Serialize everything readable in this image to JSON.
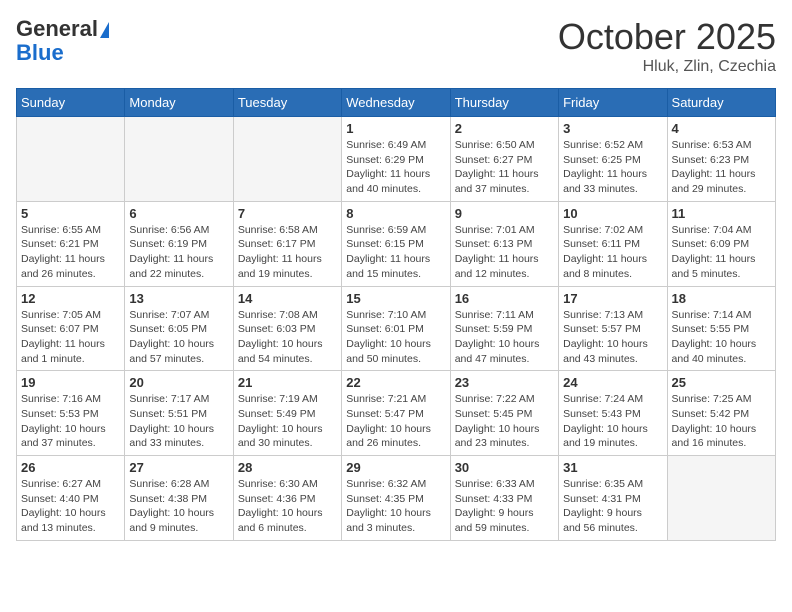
{
  "header": {
    "logo_general": "General",
    "logo_blue": "Blue",
    "month": "October 2025",
    "location": "Hluk, Zlin, Czechia"
  },
  "days_of_week": [
    "Sunday",
    "Monday",
    "Tuesday",
    "Wednesday",
    "Thursday",
    "Friday",
    "Saturday"
  ],
  "weeks": [
    [
      {
        "day": "",
        "info": ""
      },
      {
        "day": "",
        "info": ""
      },
      {
        "day": "",
        "info": ""
      },
      {
        "day": "1",
        "info": "Sunrise: 6:49 AM\nSunset: 6:29 PM\nDaylight: 11 hours\nand 40 minutes."
      },
      {
        "day": "2",
        "info": "Sunrise: 6:50 AM\nSunset: 6:27 PM\nDaylight: 11 hours\nand 37 minutes."
      },
      {
        "day": "3",
        "info": "Sunrise: 6:52 AM\nSunset: 6:25 PM\nDaylight: 11 hours\nand 33 minutes."
      },
      {
        "day": "4",
        "info": "Sunrise: 6:53 AM\nSunset: 6:23 PM\nDaylight: 11 hours\nand 29 minutes."
      }
    ],
    [
      {
        "day": "5",
        "info": "Sunrise: 6:55 AM\nSunset: 6:21 PM\nDaylight: 11 hours\nand 26 minutes."
      },
      {
        "day": "6",
        "info": "Sunrise: 6:56 AM\nSunset: 6:19 PM\nDaylight: 11 hours\nand 22 minutes."
      },
      {
        "day": "7",
        "info": "Sunrise: 6:58 AM\nSunset: 6:17 PM\nDaylight: 11 hours\nand 19 minutes."
      },
      {
        "day": "8",
        "info": "Sunrise: 6:59 AM\nSunset: 6:15 PM\nDaylight: 11 hours\nand 15 minutes."
      },
      {
        "day": "9",
        "info": "Sunrise: 7:01 AM\nSunset: 6:13 PM\nDaylight: 11 hours\nand 12 minutes."
      },
      {
        "day": "10",
        "info": "Sunrise: 7:02 AM\nSunset: 6:11 PM\nDaylight: 11 hours\nand 8 minutes."
      },
      {
        "day": "11",
        "info": "Sunrise: 7:04 AM\nSunset: 6:09 PM\nDaylight: 11 hours\nand 5 minutes."
      }
    ],
    [
      {
        "day": "12",
        "info": "Sunrise: 7:05 AM\nSunset: 6:07 PM\nDaylight: 11 hours\nand 1 minute."
      },
      {
        "day": "13",
        "info": "Sunrise: 7:07 AM\nSunset: 6:05 PM\nDaylight: 10 hours\nand 57 minutes."
      },
      {
        "day": "14",
        "info": "Sunrise: 7:08 AM\nSunset: 6:03 PM\nDaylight: 10 hours\nand 54 minutes."
      },
      {
        "day": "15",
        "info": "Sunrise: 7:10 AM\nSunset: 6:01 PM\nDaylight: 10 hours\nand 50 minutes."
      },
      {
        "day": "16",
        "info": "Sunrise: 7:11 AM\nSunset: 5:59 PM\nDaylight: 10 hours\nand 47 minutes."
      },
      {
        "day": "17",
        "info": "Sunrise: 7:13 AM\nSunset: 5:57 PM\nDaylight: 10 hours\nand 43 minutes."
      },
      {
        "day": "18",
        "info": "Sunrise: 7:14 AM\nSunset: 5:55 PM\nDaylight: 10 hours\nand 40 minutes."
      }
    ],
    [
      {
        "day": "19",
        "info": "Sunrise: 7:16 AM\nSunset: 5:53 PM\nDaylight: 10 hours\nand 37 minutes."
      },
      {
        "day": "20",
        "info": "Sunrise: 7:17 AM\nSunset: 5:51 PM\nDaylight: 10 hours\nand 33 minutes."
      },
      {
        "day": "21",
        "info": "Sunrise: 7:19 AM\nSunset: 5:49 PM\nDaylight: 10 hours\nand 30 minutes."
      },
      {
        "day": "22",
        "info": "Sunrise: 7:21 AM\nSunset: 5:47 PM\nDaylight: 10 hours\nand 26 minutes."
      },
      {
        "day": "23",
        "info": "Sunrise: 7:22 AM\nSunset: 5:45 PM\nDaylight: 10 hours\nand 23 minutes."
      },
      {
        "day": "24",
        "info": "Sunrise: 7:24 AM\nSunset: 5:43 PM\nDaylight: 10 hours\nand 19 minutes."
      },
      {
        "day": "25",
        "info": "Sunrise: 7:25 AM\nSunset: 5:42 PM\nDaylight: 10 hours\nand 16 minutes."
      }
    ],
    [
      {
        "day": "26",
        "info": "Sunrise: 6:27 AM\nSunset: 4:40 PM\nDaylight: 10 hours\nand 13 minutes."
      },
      {
        "day": "27",
        "info": "Sunrise: 6:28 AM\nSunset: 4:38 PM\nDaylight: 10 hours\nand 9 minutes."
      },
      {
        "day": "28",
        "info": "Sunrise: 6:30 AM\nSunset: 4:36 PM\nDaylight: 10 hours\nand 6 minutes."
      },
      {
        "day": "29",
        "info": "Sunrise: 6:32 AM\nSunset: 4:35 PM\nDaylight: 10 hours\nand 3 minutes."
      },
      {
        "day": "30",
        "info": "Sunrise: 6:33 AM\nSunset: 4:33 PM\nDaylight: 9 hours\nand 59 minutes."
      },
      {
        "day": "31",
        "info": "Sunrise: 6:35 AM\nSunset: 4:31 PM\nDaylight: 9 hours\nand 56 minutes."
      },
      {
        "day": "",
        "info": ""
      }
    ]
  ]
}
